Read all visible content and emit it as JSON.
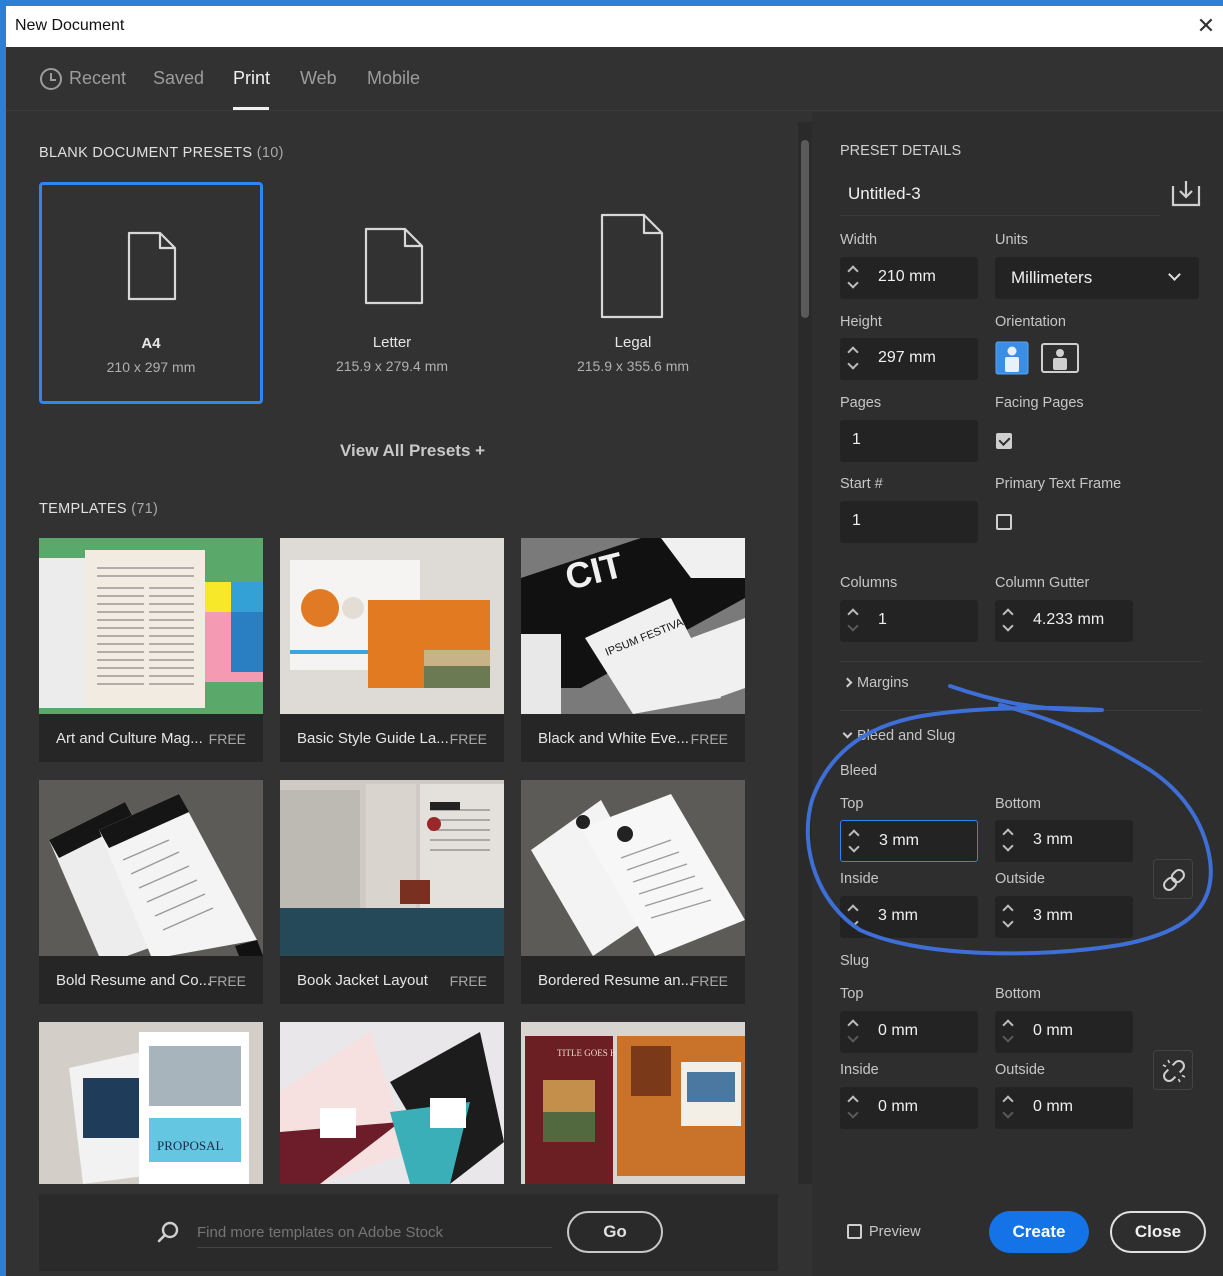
{
  "window": {
    "title": "New Document",
    "close_glyph": "✕"
  },
  "tabs": [
    {
      "label": "Recent"
    },
    {
      "label": "Saved"
    },
    {
      "label": "Print"
    },
    {
      "label": "Web"
    },
    {
      "label": "Mobile"
    }
  ],
  "active_tab": "Print",
  "presets": {
    "title": "BLANK DOCUMENT PRESETS",
    "count": "(10)",
    "items": [
      {
        "name": "A4",
        "size": "210 x 297 mm"
      },
      {
        "name": "Letter",
        "size": "215.9 x 279.4 mm"
      },
      {
        "name": "Legal",
        "size": "215.9 x 355.6 mm"
      }
    ],
    "view_all": "View All Presets +"
  },
  "templates": {
    "title": "TEMPLATES",
    "count": "(71)",
    "items": [
      {
        "name": "Art and Culture Mag...",
        "badge": "FREE"
      },
      {
        "name": "Basic Style Guide La...",
        "badge": "FREE"
      },
      {
        "name": "Black and White Eve...",
        "badge": "FREE"
      },
      {
        "name": "Bold Resume and Co...",
        "badge": "FREE"
      },
      {
        "name": "Book Jacket Layout",
        "badge": "FREE"
      },
      {
        "name": "Bordered Resume an...",
        "badge": "FREE"
      }
    ],
    "thumb_text": {
      "cit": "CIT",
      "ipsum": "IPSUM FESTIVAL",
      "proposal": "PROPOSAL",
      "title": "TITLE GOES HERE"
    }
  },
  "search": {
    "placeholder": "Find more templates on Adobe Stock",
    "go_label": "Go"
  },
  "details": {
    "header": "PRESET DETAILS",
    "doc_name": "Untitled-3",
    "width_label": "Width",
    "width_value": "210 mm",
    "units_label": "Units",
    "units_value": "Millimeters",
    "height_label": "Height",
    "height_value": "297 mm",
    "orientation_label": "Orientation",
    "pages_label": "Pages",
    "pages_value": "1",
    "facing_label": "Facing Pages",
    "facing_checked": true,
    "start_label": "Start #",
    "start_value": "1",
    "primary_label": "Primary Text Frame",
    "primary_checked": false,
    "columns_label": "Columns",
    "columns_value": "1",
    "gutter_label": "Column Gutter",
    "gutter_value": "4.233 mm",
    "margins_label": "Margins",
    "bleed_slug_label": "Bleed and Slug",
    "bleed_label": "Bleed",
    "bleed": {
      "top_label": "Top",
      "top_value": "3 mm",
      "bottom_label": "Bottom",
      "bottom_value": "3 mm",
      "inside_label": "Inside",
      "inside_value": "3 mm",
      "outside_label": "Outside",
      "outside_value": "3 mm"
    },
    "slug_label": "Slug",
    "slug": {
      "top_label": "Top",
      "top_value": "0 mm",
      "bottom_label": "Bottom",
      "bottom_value": "0 mm",
      "inside_label": "Inside",
      "inside_value": "0 mm",
      "outside_label": "Outside",
      "outside_value": "0 mm"
    },
    "preview_label": "Preview",
    "create_label": "Create",
    "close_label": "Close"
  },
  "colors": {
    "accent": "#2d87f0",
    "primary_button": "#1473e6",
    "annotation": "#3e6fd6"
  }
}
